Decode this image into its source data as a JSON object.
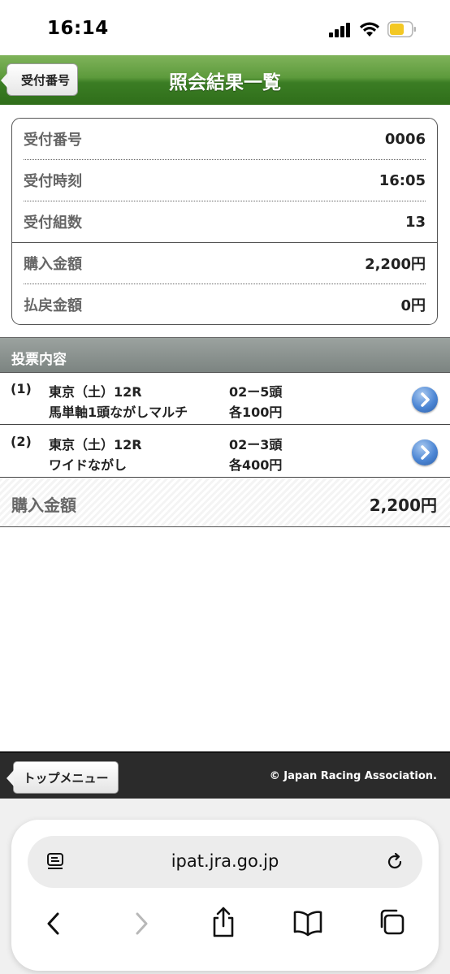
{
  "status": {
    "time": "16:14"
  },
  "nav": {
    "back_label": "受付番号",
    "title": "照会結果一覧"
  },
  "summary": [
    {
      "label": "受付番号",
      "value": "0006"
    },
    {
      "label": "受付時刻",
      "value": "16:05"
    },
    {
      "label": "受付組数",
      "value": "13"
    },
    {
      "label": "購入金額",
      "value": "2,200円"
    },
    {
      "label": "払戻金額",
      "value": "0円"
    }
  ],
  "section": {
    "title": "投票内容"
  },
  "bets": [
    {
      "num": "(1)",
      "race": "東京（土）12R",
      "type": "馬単軸1頭ながしマルチ",
      "combo": "02ー5頭",
      "amount": "各100円"
    },
    {
      "num": "(2)",
      "race": "東京（土）12R",
      "type": "ワイドながし",
      "combo": "02ー3頭",
      "amount": "各400円"
    }
  ],
  "total": {
    "label": "購入金額",
    "value": "2,200円"
  },
  "footer": {
    "top_menu_label": "トップメニュー",
    "copyright": "© Japan Racing Association."
  },
  "browser": {
    "url": "ipat.jra.go.jp"
  }
}
